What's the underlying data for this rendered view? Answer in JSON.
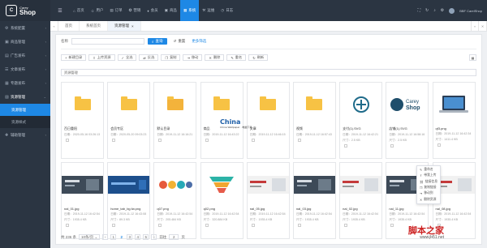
{
  "brand": {
    "small": "Carey",
    "big": "Shop",
    "badge": "C"
  },
  "sidebar": {
    "items": [
      {
        "label": "系统配置",
        "icon": "cog-icon",
        "glyph": "⚙"
      },
      {
        "label": "商品管理",
        "icon": "box-icon",
        "glyph": "▣"
      },
      {
        "label": "广告发布",
        "icon": "ad-icon",
        "glyph": "▤"
      },
      {
        "label": "文章发布",
        "icon": "article-icon",
        "glyph": "☰"
      },
      {
        "label": "专题发布",
        "icon": "topic-icon",
        "glyph": "▦"
      }
    ],
    "open_group": {
      "label": "资源管理",
      "icon": "folder-icon",
      "glyph": "▨"
    },
    "sub_items": [
      {
        "label": "资源管理",
        "active": true
      },
      {
        "label": "资源样式",
        "active": false
      }
    ],
    "last_item": {
      "label": "辅助管理",
      "icon": "tools-icon",
      "glyph": "✚"
    }
  },
  "topnav": {
    "tabs": [
      {
        "label": "首页",
        "glyph": "⌂"
      },
      {
        "label": "用户",
        "glyph": "☺"
      },
      {
        "label": "订单",
        "glyph": "▤"
      },
      {
        "label": "营销",
        "glyph": "✪"
      },
      {
        "label": "会员",
        "glyph": "♦"
      },
      {
        "label": "商品",
        "glyph": "▣"
      },
      {
        "label": "系统",
        "glyph": "▦"
      },
      {
        "label": "运维",
        "glyph": "⚒"
      },
      {
        "label": "日志",
        "glyph": "◷"
      }
    ],
    "active_index": 6,
    "user": "BBF CarelShop"
  },
  "page_tabs": [
    {
      "label": "首页",
      "active": false,
      "closable": false
    },
    {
      "label": "系统首页",
      "active": false,
      "closable": false
    },
    {
      "label": "资源管理",
      "active": true,
      "closable": true
    }
  ],
  "filter": {
    "label": "名称",
    "search": "查询",
    "reset": "重置",
    "more": "更多筛选"
  },
  "toolbar": [
    {
      "label": "新建目录",
      "glyph": "+"
    },
    {
      "label": "上传资源",
      "glyph": "⇪"
    },
    {
      "label": "全选",
      "glyph": "✓"
    },
    {
      "label": "反选",
      "glyph": "⇄"
    },
    {
      "label": "复制",
      "glyph": "❐"
    },
    {
      "label": "移动",
      "glyph": "⇥"
    },
    {
      "label": "删除",
      "glyph": "✕"
    },
    {
      "label": "重名",
      "glyph": "✎"
    },
    {
      "label": "刷新",
      "glyph": "↻"
    }
  ],
  "breadcrumb": "资源管理",
  "files_row1": [
    {
      "name": "百日重阳",
      "kind": "folder",
      "date": "日期：2020-05-16 03:26:13"
    },
    {
      "name": "会员专区",
      "kind": "folder",
      "date": "日期：2020-05-20 09:03:23"
    },
    {
      "name": "默认目录",
      "kind": "folder-open",
      "date": "日期：2019-11-12 16:16:21"
    },
    {
      "name": "商品",
      "kind": "folder",
      "date": "日期：2019-11-12 16:43:22"
    },
    {
      "name": "文章",
      "kind": "folder",
      "date": "日期：2019-11-12 16:46:15"
    },
    {
      "name": "视频",
      "kind": "folder",
      "date": "日期：2019-11-12 16:57:43"
    },
    {
      "name": "支付(1).SVG",
      "kind": "logo-circle",
      "date": "日期：2019-11-12 16:42:21",
      "size": "尺寸：2.5 KB"
    },
    {
      "name": "店铺(1).SVG",
      "kind": "logo-carey",
      "date": "日期：2019-11-12 16:58:16",
      "size": "尺寸：2.5 KB"
    },
    {
      "name": "qf3.png",
      "kind": "laptop",
      "date": "日期：2019-11-12 16:42:34",
      "size": "尺寸：1411.4 KB"
    }
  ],
  "files_row2": [
    {
      "name": "nal_01.jpg",
      "kind": "banner-dark",
      "date": "日期：2019-11-12 16:42:54",
      "size": "尺寸：1935.4 KB"
    },
    {
      "name": "home_tab_bg.fw.png",
      "kind": "banner-blue",
      "date": "日期：2019-11-12 16:43:08",
      "size": "尺寸：89.3 KB"
    },
    {
      "name": "q07.png",
      "kind": "infographic",
      "date": "日期：2019-11-12 16:42:54",
      "size": "尺寸：205.484 KB"
    },
    {
      "name": "q02.png",
      "kind": "funnel",
      "date": "日期：2019-11-12 16:42:54",
      "size": "尺寸：320.884 KB"
    },
    {
      "name": "nal_05.jpg",
      "kind": "banner-red",
      "date": "日期：2019-11-12 16:42:54",
      "size": "尺寸：1935.4 KB"
    },
    {
      "name": "nal_03.jpg",
      "kind": "banner-dark",
      "date": "日期：2019-11-12 16:42:54",
      "size": "尺寸：1935.4 KB"
    },
    {
      "name": "nal_02.jpg",
      "kind": "banner-red",
      "date": "日期：2019-11-12 16:42:54",
      "size": "尺寸：1935.4 KB"
    },
    {
      "name": "nal_11.jpg",
      "kind": "banner-dark",
      "date": "日期：2019-11-12 16:42:54",
      "size": "尺寸：1935.4 KB"
    },
    {
      "name": "nal_08.jpg",
      "kind": "banner-red",
      "date": "日期：2019-11-12 16:42:54",
      "size": "尺寸：1935.4 KB"
    }
  ],
  "context_menu": [
    {
      "label": "重命名",
      "glyph": "✎"
    },
    {
      "label": "带我上传",
      "glyph": "⇪"
    },
    {
      "label": "链接信息",
      "glyph": "⛓"
    },
    {
      "label": "复制链接",
      "glyph": "❐"
    },
    {
      "label": "移动到",
      "glyph": "⇥"
    },
    {
      "label": "删除资源",
      "glyph": "✕"
    }
  ],
  "pagination": {
    "total": "共 236 条",
    "per_page": "10条/页",
    "pages": [
      "1",
      "2",
      "3",
      "4",
      "5"
    ],
    "current": "2",
    "goto_label": "前往",
    "goto_value": "2",
    "page_suffix": "页"
  },
  "watermark": {
    "main": "脚本之家",
    "url": "www.jb51.net"
  },
  "china_watermark": {
    "main": "China",
    "sub": "China Wallpaper · 电脑下载"
  },
  "colors": {
    "sidebar_bg": "#2b3542",
    "accent": "#1e88e5",
    "folder": "#f7c244",
    "watermark": "#cc2222"
  }
}
